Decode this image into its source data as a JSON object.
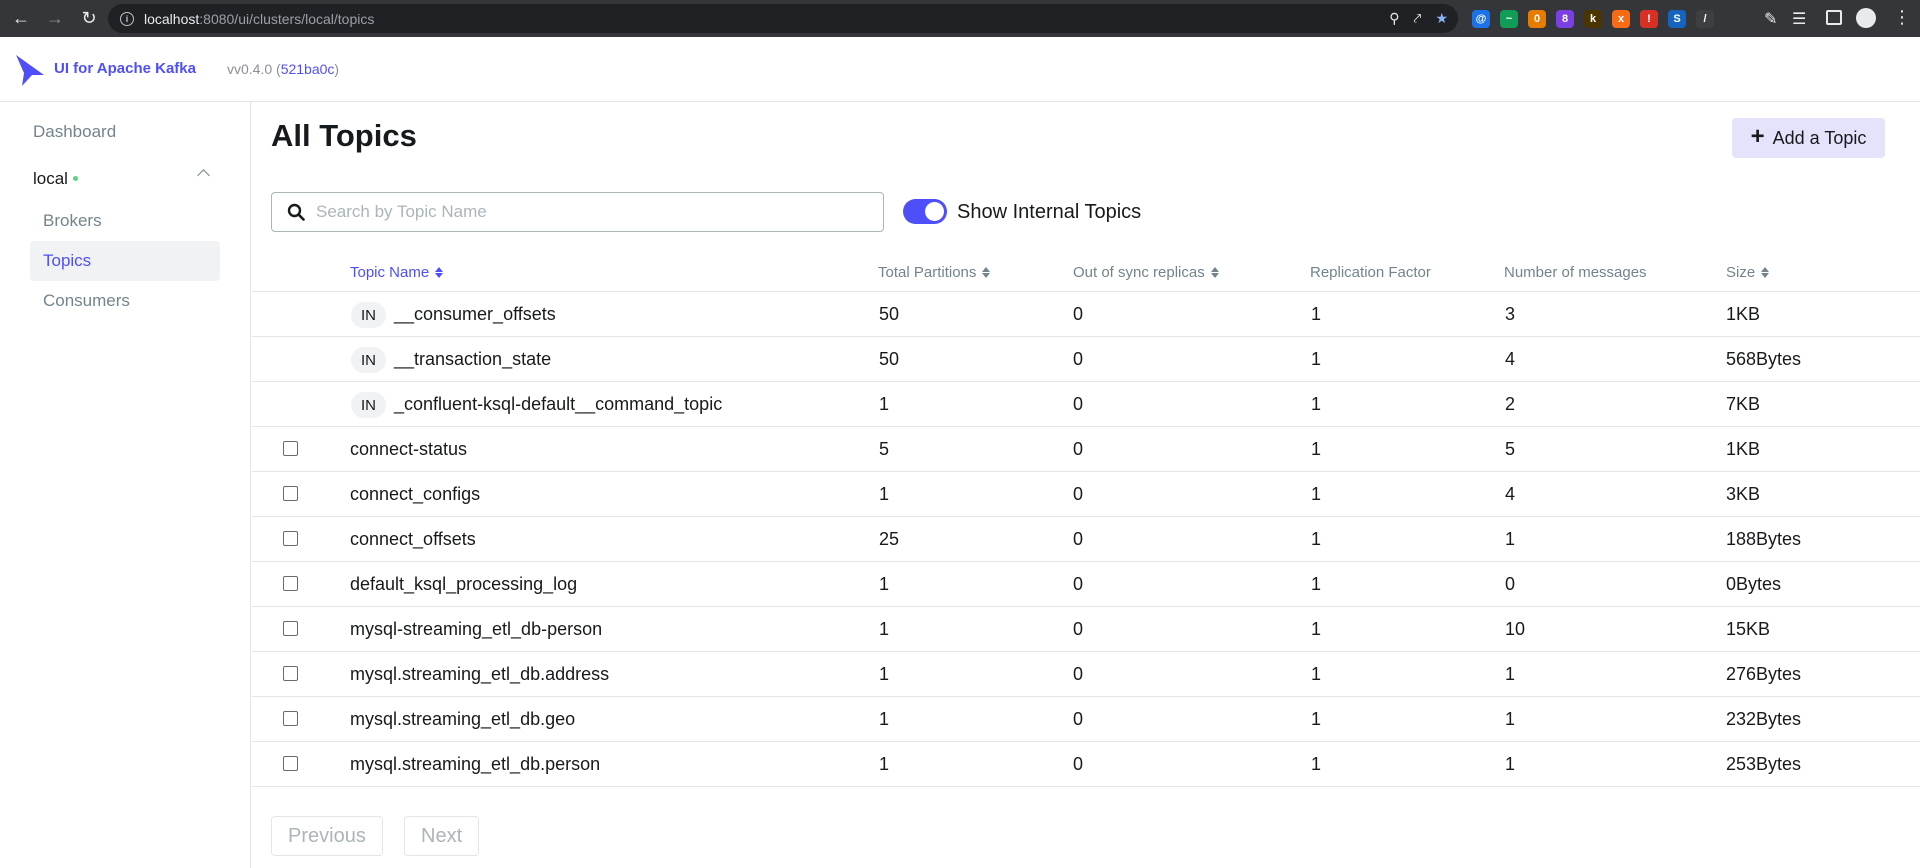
{
  "browser": {
    "url_host": "localhost",
    "url_path": ":8080/ui/clusters/local/topics",
    "extensions": [
      {
        "name": "at-icon",
        "color": "#1a73e8",
        "glyph": "@"
      },
      {
        "name": "green-ext-icon",
        "color": "#0f9d58",
        "glyph": "~"
      },
      {
        "name": "ext-badge-0-icon",
        "color": "#e67c00",
        "glyph": "0"
      },
      {
        "name": "ext-badge-8-icon",
        "color": "#7b3fe4",
        "glyph": "8"
      },
      {
        "name": "k-icon",
        "color": "#4a3500",
        "glyph": "k"
      },
      {
        "name": "orange-x-icon",
        "color": "#f76b15",
        "glyph": "x"
      },
      {
        "name": "red-ext-icon",
        "color": "#d93025",
        "glyph": "!"
      },
      {
        "name": "s-icon",
        "color": "#1565c0",
        "glyph": "S"
      },
      {
        "name": "slash-icon",
        "color": "#3c4043",
        "glyph": "/"
      }
    ]
  },
  "header": {
    "brand": "UI for Apache Kafka",
    "version_prefix": "vv0.4.0 (",
    "version_hash": "521ba0c",
    "version_suffix": ")"
  },
  "sidebar": {
    "dashboard": "Dashboard",
    "cluster": "local",
    "items": [
      {
        "label": "Brokers",
        "active": false
      },
      {
        "label": "Topics",
        "active": true
      },
      {
        "label": "Consumers",
        "active": false
      }
    ]
  },
  "main": {
    "title": "All Topics",
    "add_button": "Add a Topic",
    "search_placeholder": "Search by Topic Name",
    "toggle_label": "Show Internal Topics",
    "toggle_on": true,
    "columns": {
      "name": "Topic Name",
      "partitions": "Total Partitions",
      "out_of_sync": "Out of sync replicas",
      "replication": "Replication Factor",
      "messages": "Number of messages",
      "size": "Size"
    },
    "internal_badge": "IN",
    "rows": [
      {
        "name": "__consumer_offsets",
        "internal": true,
        "partitions": "50",
        "out_of_sync": "0",
        "replication": "1",
        "messages": "3",
        "size": "1KB"
      },
      {
        "name": "__transaction_state",
        "internal": true,
        "partitions": "50",
        "out_of_sync": "0",
        "replication": "1",
        "messages": "4",
        "size": "568Bytes"
      },
      {
        "name": "_confluent-ksql-default__command_topic",
        "internal": true,
        "partitions": "1",
        "out_of_sync": "0",
        "replication": "1",
        "messages": "2",
        "size": "7KB"
      },
      {
        "name": "connect-status",
        "internal": false,
        "partitions": "5",
        "out_of_sync": "0",
        "replication": "1",
        "messages": "5",
        "size": "1KB"
      },
      {
        "name": "connect_configs",
        "internal": false,
        "partitions": "1",
        "out_of_sync": "0",
        "replication": "1",
        "messages": "4",
        "size": "3KB"
      },
      {
        "name": "connect_offsets",
        "internal": false,
        "partitions": "25",
        "out_of_sync": "0",
        "replication": "1",
        "messages": "1",
        "size": "188Bytes"
      },
      {
        "name": "default_ksql_processing_log",
        "internal": false,
        "partitions": "1",
        "out_of_sync": "0",
        "replication": "1",
        "messages": "0",
        "size": "0Bytes"
      },
      {
        "name": "mysql-streaming_etl_db-person",
        "internal": false,
        "partitions": "1",
        "out_of_sync": "0",
        "replication": "1",
        "messages": "10",
        "size": "15KB"
      },
      {
        "name": "mysql.streaming_etl_db.address",
        "internal": false,
        "partitions": "1",
        "out_of_sync": "0",
        "replication": "1",
        "messages": "1",
        "size": "276Bytes"
      },
      {
        "name": "mysql.streaming_etl_db.geo",
        "internal": false,
        "partitions": "1",
        "out_of_sync": "0",
        "replication": "1",
        "messages": "1",
        "size": "232Bytes"
      },
      {
        "name": "mysql.streaming_etl_db.person",
        "internal": false,
        "partitions": "1",
        "out_of_sync": "0",
        "replication": "1",
        "messages": "1",
        "size": "253Bytes"
      }
    ],
    "pager": {
      "previous": "Previous",
      "next": "Next"
    }
  }
}
